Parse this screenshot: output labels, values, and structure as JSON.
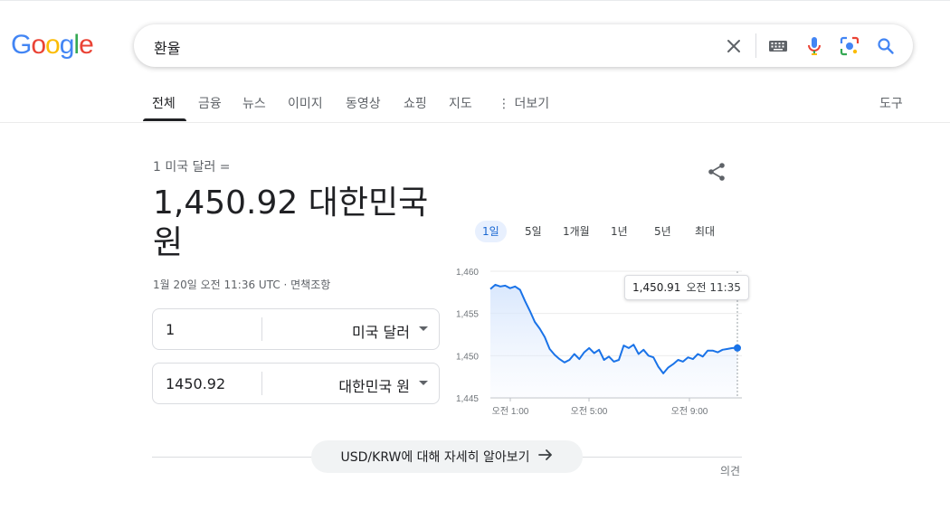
{
  "logo": [
    "G",
    "o",
    "o",
    "g",
    "l",
    "e"
  ],
  "search": {
    "query": "환율"
  },
  "tabs": [
    {
      "label": "전체"
    },
    {
      "label": "금융"
    },
    {
      "label": "뉴스"
    },
    {
      "label": "이미지"
    },
    {
      "label": "동영상"
    },
    {
      "label": "쇼핑"
    },
    {
      "label": "지도"
    },
    {
      "label": "더보기"
    }
  ],
  "tools_label": "도구",
  "converter": {
    "from_label": "1 미국 달러 =",
    "result_number": "1,450.92",
    "result_currency": "대한민국 원",
    "timestamp": "1월 20일 오전 11:36 UTC · ",
    "disclaimer": "면책조항",
    "from_amount": "1",
    "from_currency": "미국 달러",
    "to_amount": "1450.92",
    "to_currency": "대한민국 원"
  },
  "ranges": [
    {
      "label": "1일",
      "selected": true
    },
    {
      "label": "5일"
    },
    {
      "label": "1개월"
    },
    {
      "label": "1년"
    },
    {
      "label": "5년"
    },
    {
      "label": "최대"
    }
  ],
  "tooltip": {
    "value": "1,450.91",
    "time": "오전 11:35"
  },
  "chart_data": {
    "type": "area",
    "ylim": [
      1445,
      1460
    ],
    "yticks": [
      "1,445",
      "1,450",
      "1,455",
      "1,460"
    ],
    "xticks": [
      "오전 1:00",
      "오전 5:00",
      "오전 9:00"
    ],
    "series": [
      {
        "values": [
          1457.9,
          1458.4,
          1458.2,
          1458.3,
          1458.0,
          1458.2,
          1457.8,
          1456.5,
          1455.3,
          1454.0,
          1453.2,
          1452.2,
          1450.8,
          1450.1,
          1449.6,
          1449.2,
          1449.5,
          1450.2,
          1449.6,
          1450.4,
          1450.9,
          1450.3,
          1450.7,
          1449.5,
          1449.9,
          1449.3,
          1449.5,
          1451.2,
          1450.9,
          1451.3,
          1450.2,
          1450.7,
          1450.0,
          1449.8,
          1448.7,
          1447.9,
          1448.6,
          1449.0,
          1449.5,
          1449.3,
          1449.8,
          1449.6,
          1450.2,
          1449.9,
          1450.6,
          1450.6,
          1450.4,
          1450.7,
          1450.8,
          1450.9,
          1450.91
        ],
        "color": "#1a73e8"
      }
    ]
  },
  "more_button": "USD/KRW에 대해 자세히 알아보기",
  "feedback": "의견"
}
